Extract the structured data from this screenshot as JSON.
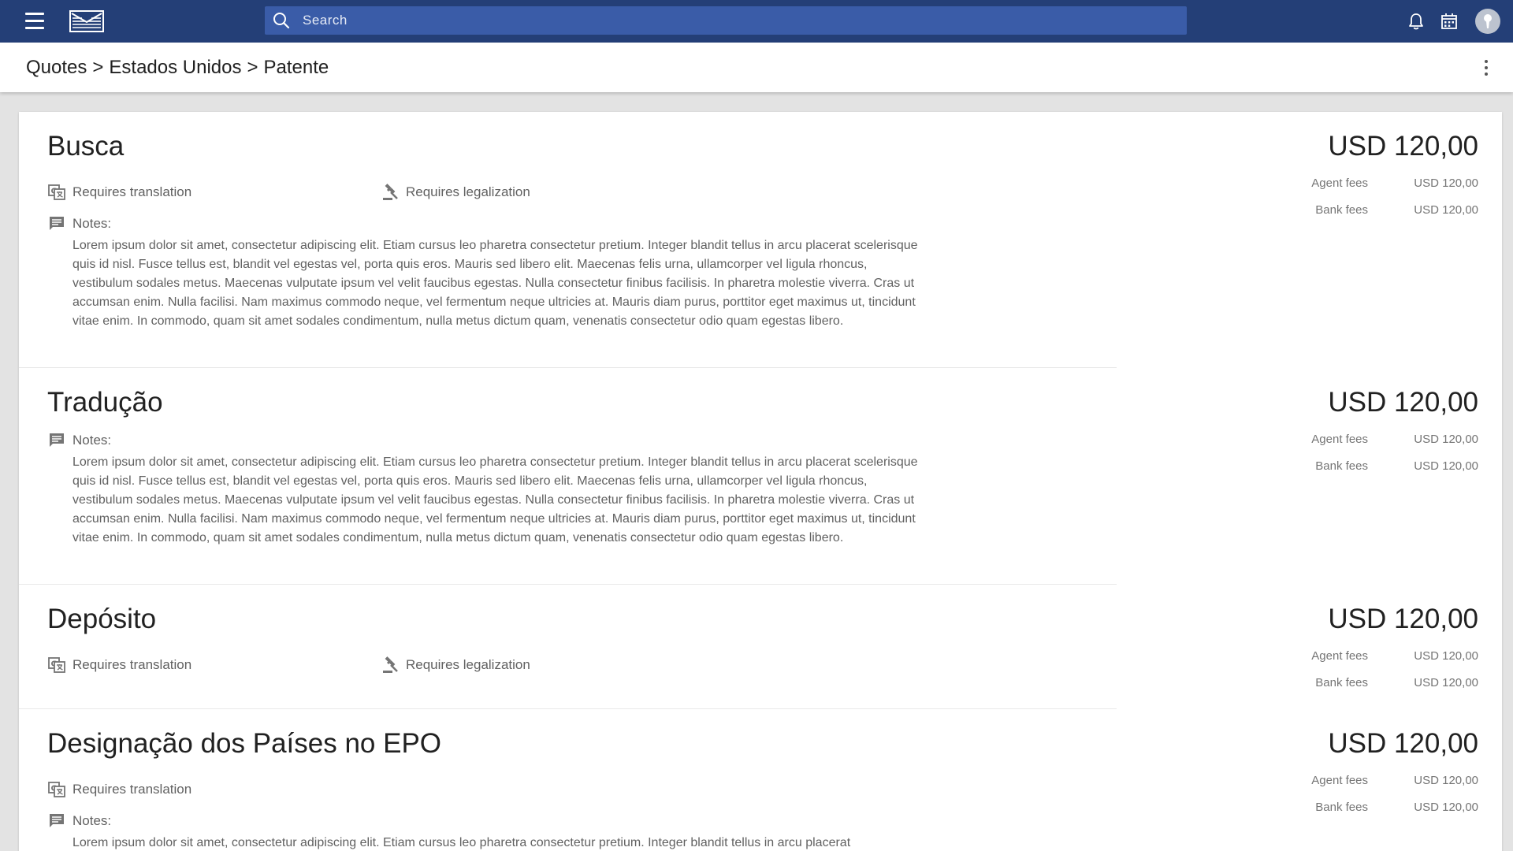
{
  "header": {
    "search_placeholder": "Search"
  },
  "breadcrumb": {
    "items": [
      "Quotes",
      "Estados Unidos",
      "Patente"
    ],
    "separator": ">"
  },
  "labels": {
    "requires_translation": "Requires translation",
    "requires_legalization": "Requires legalization",
    "notes": "Notes:",
    "agent_fees": "Agent fees",
    "bank_fees": "Bank fees"
  },
  "sections": [
    {
      "title": "Busca",
      "price": "USD 120,00",
      "agent_fees": "USD 120,00",
      "bank_fees": "USD 120,00",
      "notes_text": "Lorem ipsum dolor sit amet, consectetur adipiscing elit. Etiam cursus leo pharetra consectetur pretium. Integer blandit tellus in arcu placerat scelerisque quis id nisl. Fusce tellus est, blandit vel egestas vel, porta quis eros. Mauris sed libero elit. Maecenas felis urna, ullamcorper vel ligula rhoncus, vestibulum sodales metus. Maecenas vulputate ipsum vel velit faucibus egestas. Nulla consectetur finibus facilisis. In pharetra molestie viverra. Cras ut accumsan enim. Nulla facilisi. Nam maximus commodo neque, vel fermentum neque ultricies at. Mauris diam purus, porttitor eget maximus ut, tincidunt vitae enim. In commodo, quam sit amet sodales condimentum, nulla metus dictum quam, venenatis consectetur odio quam egestas libero."
    },
    {
      "title": "Tradução",
      "price": "USD 120,00",
      "agent_fees": "USD 120,00",
      "bank_fees": "USD 120,00",
      "notes_text": "Lorem ipsum dolor sit amet, consectetur adipiscing elit. Etiam cursus leo pharetra consectetur pretium. Integer blandit tellus in arcu placerat scelerisque quis id nisl. Fusce tellus est, blandit vel egestas vel, porta quis eros. Mauris sed libero elit. Maecenas felis urna, ullamcorper vel ligula rhoncus, vestibulum sodales metus. Maecenas vulputate ipsum vel velit faucibus egestas. Nulla consectetur finibus facilisis. In pharetra molestie viverra. Cras ut accumsan enim. Nulla facilisi. Nam maximus commodo neque, vel fermentum neque ultricies at. Mauris diam purus, porttitor eget maximus ut, tincidunt vitae enim. In commodo, quam sit amet sodales condimentum, nulla metus dictum quam, venenatis consectetur odio quam egestas libero."
    },
    {
      "title": "Depósito",
      "price": "USD 120,00",
      "agent_fees": "USD 120,00",
      "bank_fees": "USD 120,00"
    },
    {
      "title": "Designação dos Países no EPO",
      "price": "USD 120,00",
      "agent_fees": "USD 120,00",
      "bank_fees": "USD 120,00",
      "notes_text": "Lorem ipsum dolor sit amet, consectetur adipiscing elit. Etiam cursus leo pharetra consectetur pretium. Integer blandit tellus in arcu placerat"
    }
  ]
}
